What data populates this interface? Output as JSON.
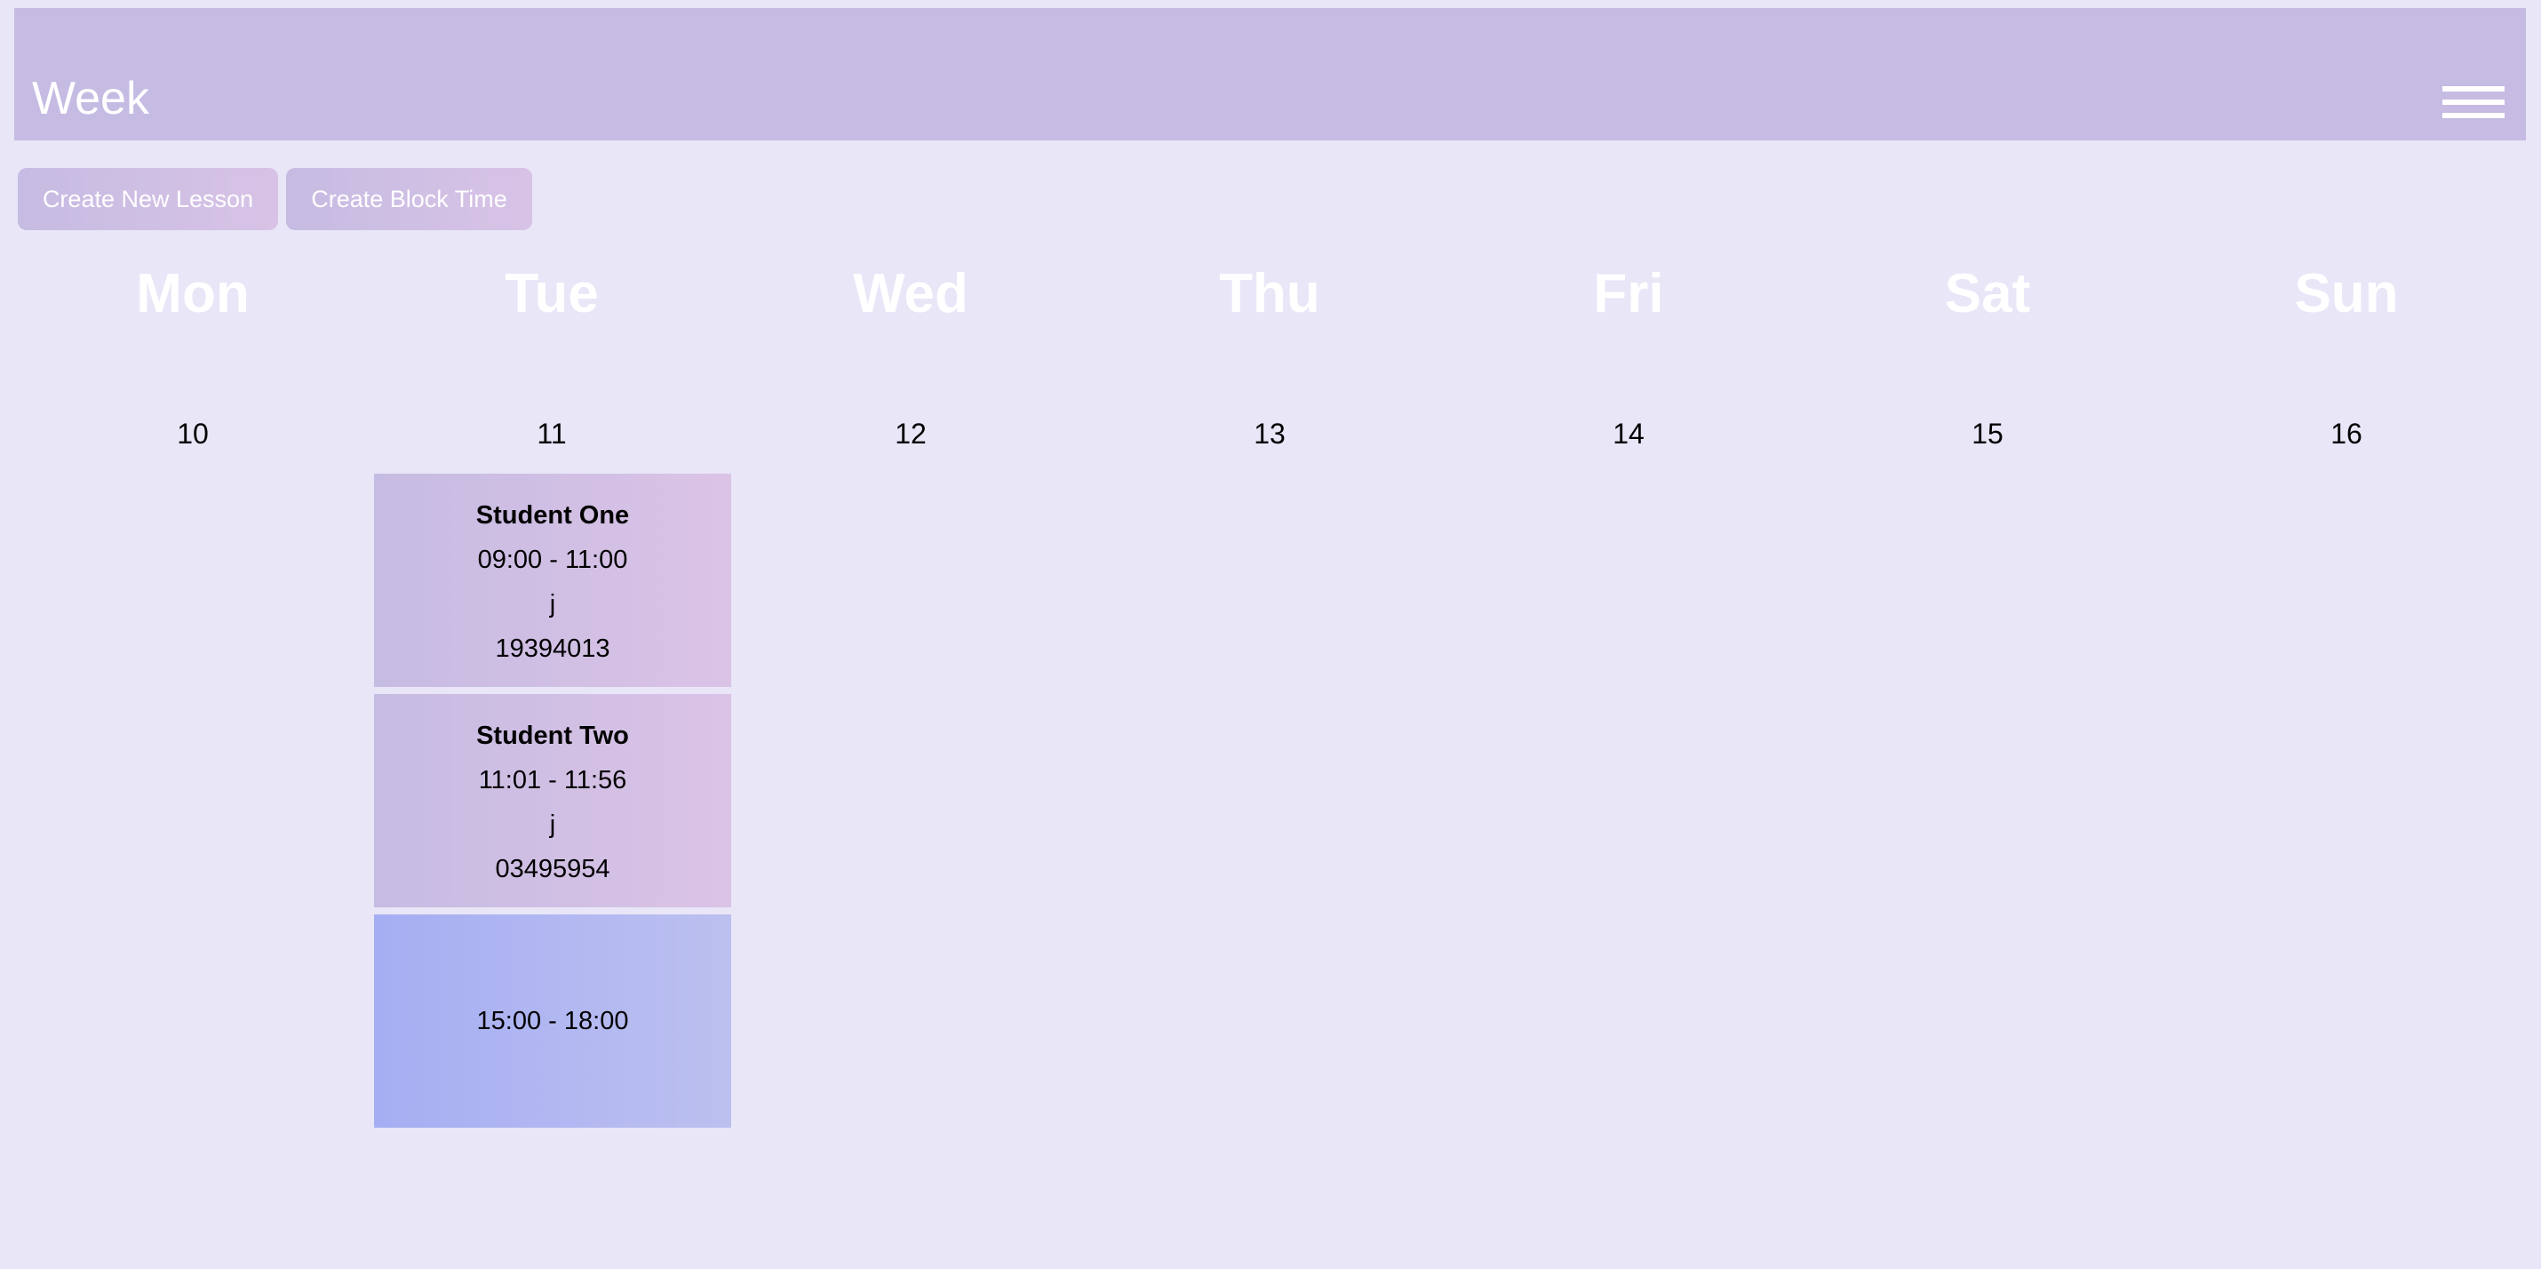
{
  "header": {
    "title": "Week",
    "menu_icon": "hamburger-menu-icon"
  },
  "toolbar": {
    "create_lesson_label": "Create New Lesson",
    "create_block_label": "Create Block Time"
  },
  "week": {
    "days": [
      {
        "name": "Mon",
        "date": "10"
      },
      {
        "name": "Tue",
        "date": "11"
      },
      {
        "name": "Wed",
        "date": "12"
      },
      {
        "name": "Thu",
        "date": "13"
      },
      {
        "name": "Fri",
        "date": "14"
      },
      {
        "name": "Sat",
        "date": "15"
      },
      {
        "name": "Sun",
        "date": "16"
      }
    ]
  },
  "events": [
    {
      "type": "lesson",
      "student": "Student One",
      "time": "09:00 - 11:00",
      "note": "j",
      "phone": "19394013"
    },
    {
      "type": "lesson",
      "student": "Student Two",
      "time": "11:01 - 11:56",
      "note": "j",
      "phone": "03495954"
    },
    {
      "type": "block",
      "time": "15:00 - 18:00"
    }
  ],
  "colors": {
    "background": "#e8e6f7",
    "header": "#c6bbe2",
    "lesson": "#d0bfe4",
    "block": "#aeb4f1"
  }
}
